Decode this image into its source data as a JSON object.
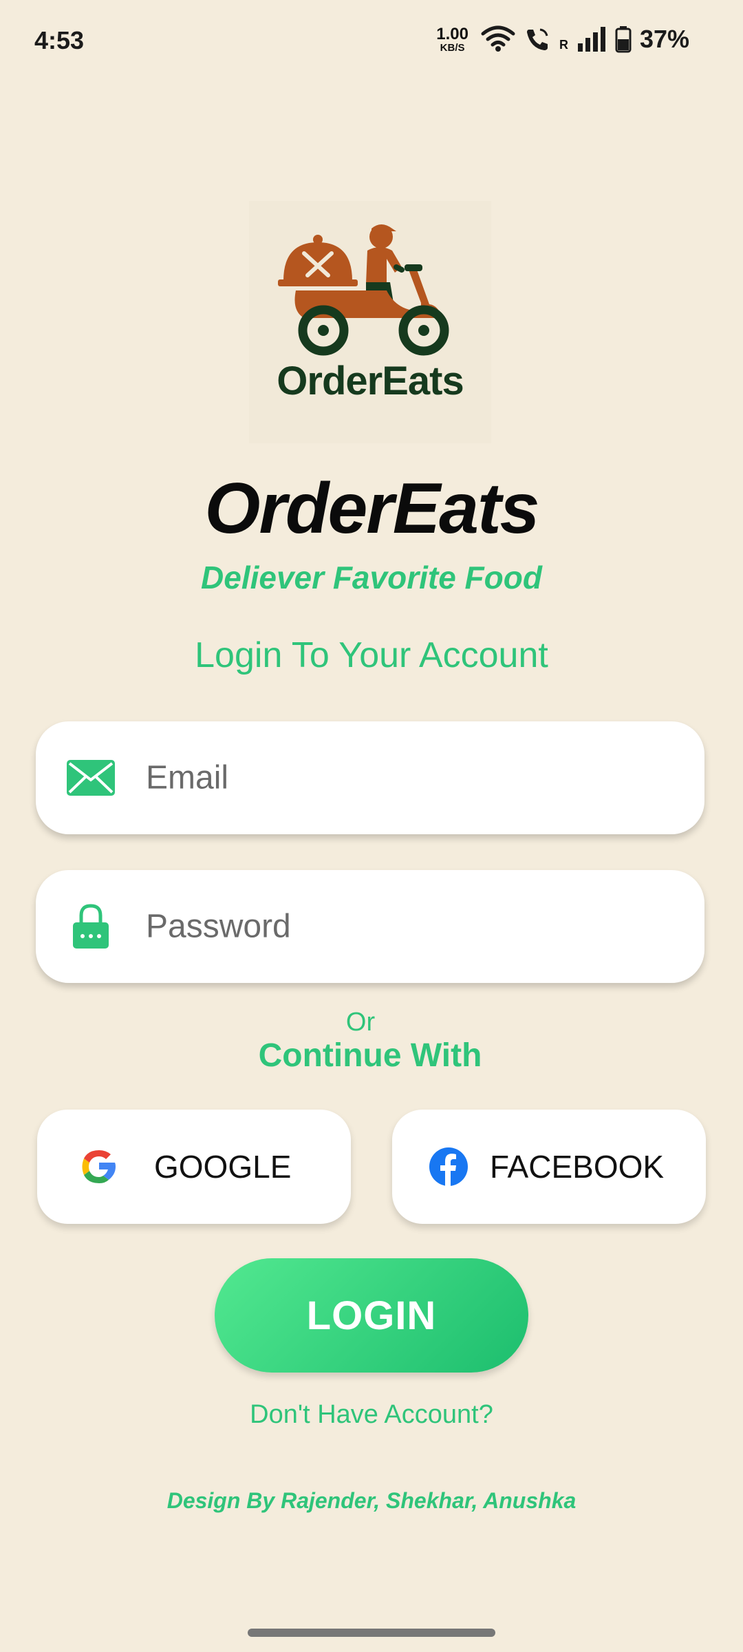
{
  "status_bar": {
    "time": "4:53",
    "net_speed_value": "1.00",
    "net_speed_unit": "KB/S",
    "roaming": "R",
    "battery": "37%",
    "icons": [
      "wifi-icon",
      "call-icon",
      "signal-icon",
      "battery-icon"
    ]
  },
  "logo": {
    "text": "OrderEats"
  },
  "app_title": "OrderEats",
  "tagline": "Deliever Favorite Food",
  "login_heading": "Login To Your Account",
  "email_field": {
    "placeholder": "Email",
    "value": "",
    "icon": "email-icon"
  },
  "password_field": {
    "placeholder": "Password",
    "value": "",
    "icon": "lock-icon"
  },
  "or_text": "Or",
  "continue_text": "Continue With",
  "social": {
    "google_label": "GOOGLE",
    "facebook_label": "FACEBOOK"
  },
  "login_button": "LOGIN",
  "signup_link": "Don't Have Account?",
  "credits": "Design By Rajender, Shekhar, Anushka",
  "colors": {
    "background": "#F4ECDC",
    "accent": "#2FC47A",
    "logo_brown": "#B5561F",
    "logo_dark_green": "#163A1E"
  }
}
